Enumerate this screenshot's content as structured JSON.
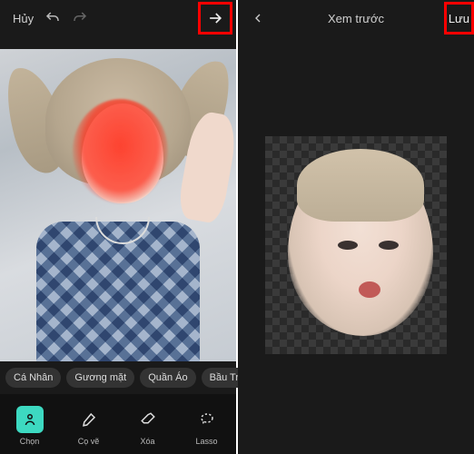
{
  "left": {
    "cancel": "Hủy",
    "categories": [
      "Cá Nhân",
      "Gương mặt",
      "Quần Áo",
      "Bầu Trời"
    ],
    "tools": [
      {
        "key": "select",
        "label": "Chọn"
      },
      {
        "key": "brush",
        "label": "Cọ vẽ"
      },
      {
        "key": "erase",
        "label": "Xóa"
      },
      {
        "key": "lasso",
        "label": "Lasso"
      }
    ],
    "active_tool": "select"
  },
  "right": {
    "title": "Xem trước",
    "save": "Lưu"
  },
  "accent": "#3dd9c1",
  "highlight": "#ff0000"
}
